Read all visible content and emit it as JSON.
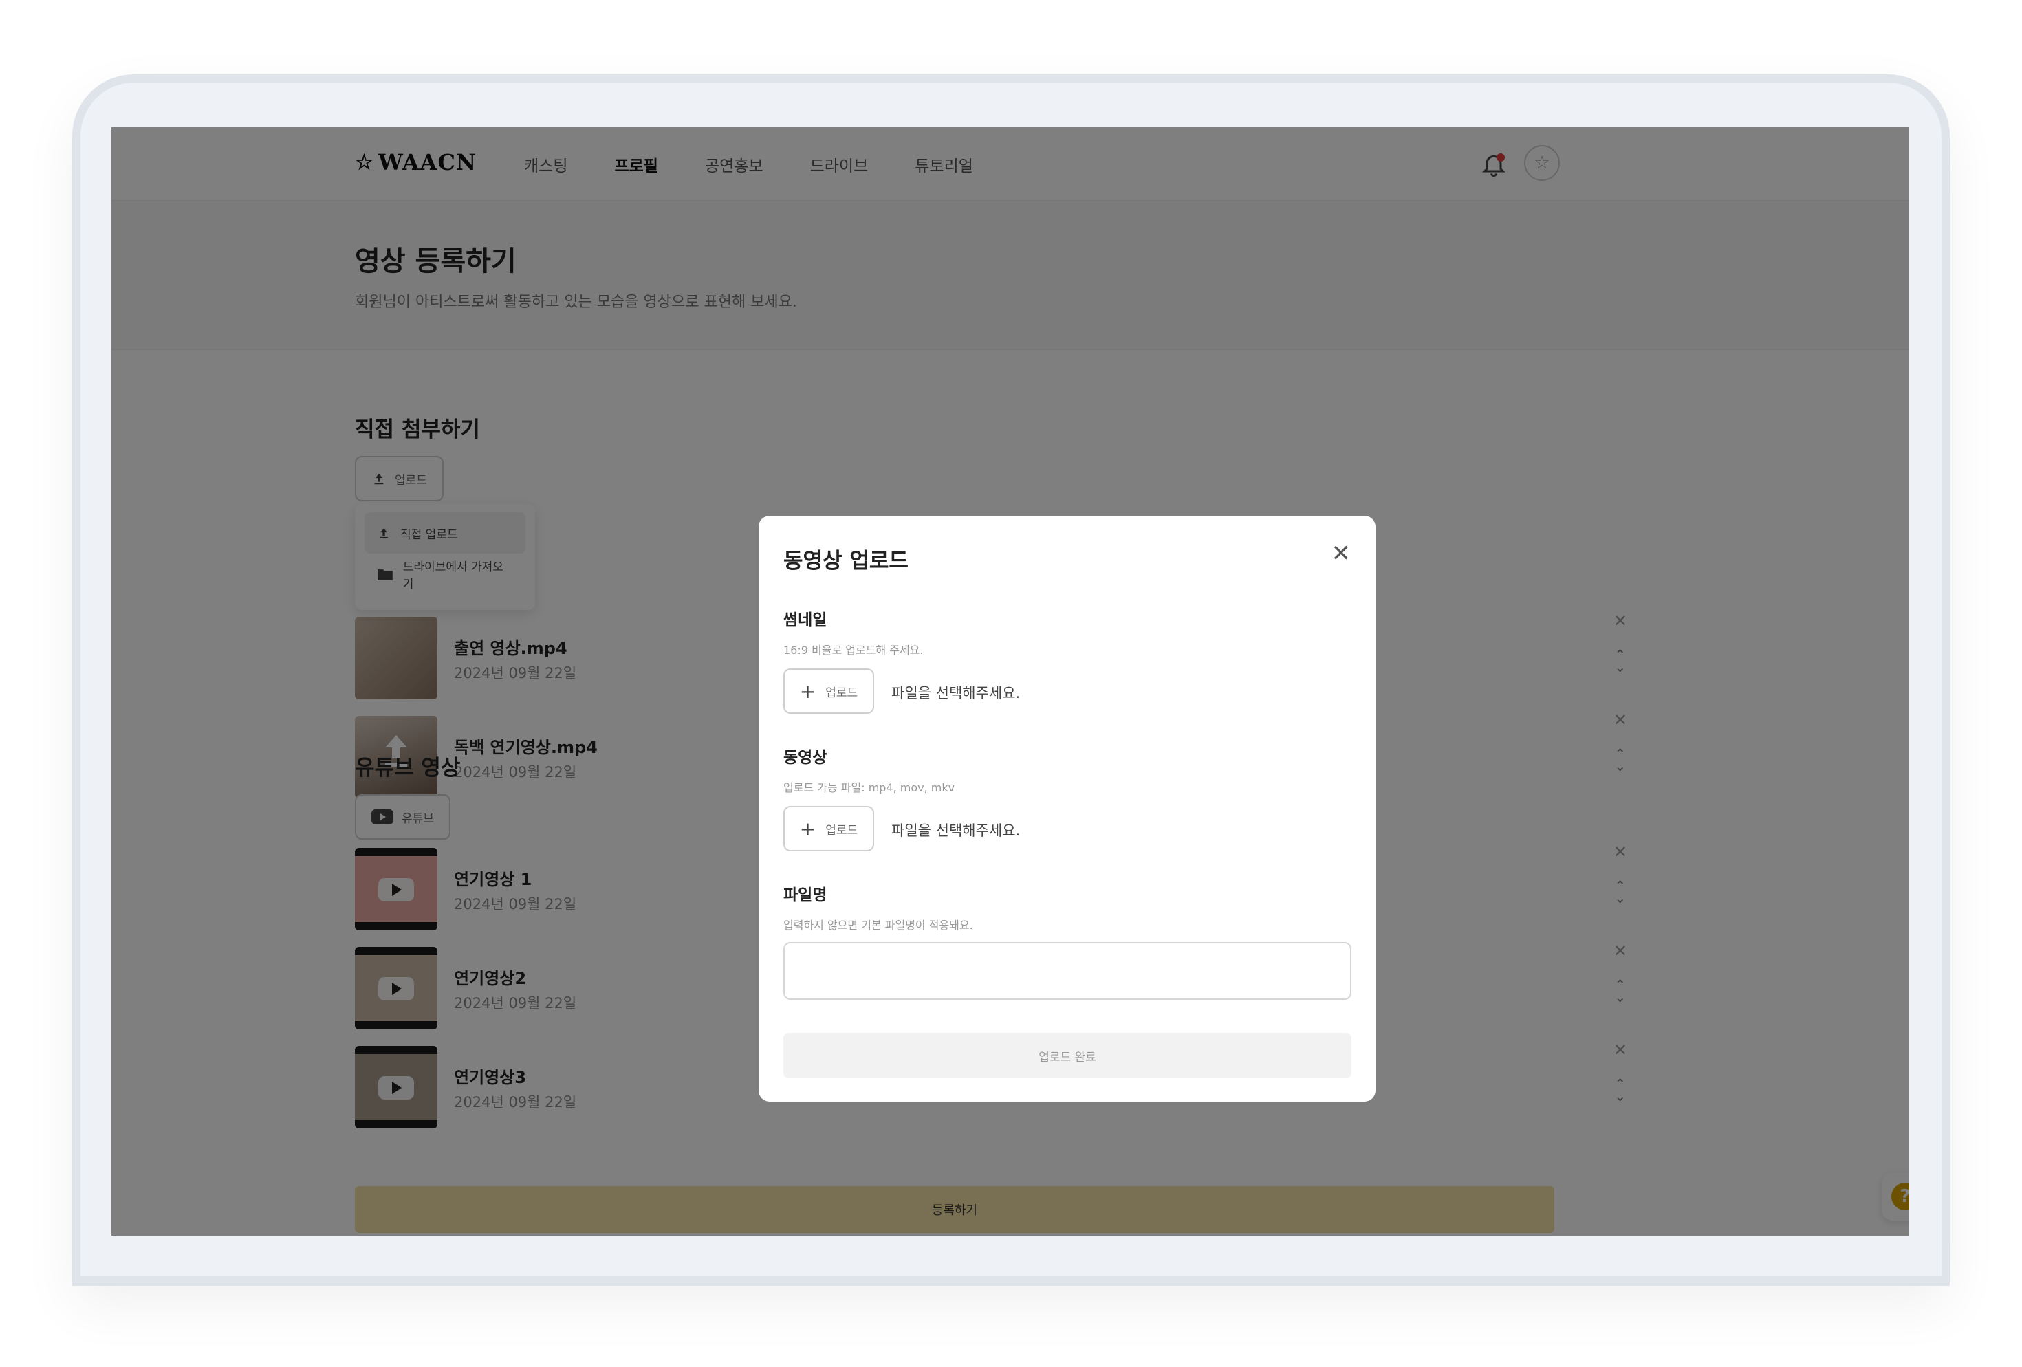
{
  "header": {
    "logo": "WAACN",
    "nav": [
      "캐스팅",
      "프로필",
      "공연홍보",
      "드라이브",
      "튜토리얼"
    ],
    "active_nav": "프로필"
  },
  "hero": {
    "title": "영상 등록하기",
    "description": "회원님이 아티스트로써 활동하고 있는 모습을 영상으로 표현해 보세요."
  },
  "direct": {
    "title": "직접 첨부하기",
    "upload_label": "업로드",
    "dropdown": [
      "직접 업로드",
      "드라이브에서 가져오기"
    ],
    "items": [
      {
        "title": "출연 영상.mp4",
        "date": "2024년 09월 22일"
      },
      {
        "title": "독백 연기영상.mp4",
        "date": "2024년 09월 22일"
      }
    ]
  },
  "youtube": {
    "title": "유튜브 영상",
    "button_label": "유튜브",
    "items": [
      {
        "title": "연기영상 1",
        "date": "2024년 09월 22일"
      },
      {
        "title": "연기영상2",
        "date": "2024년 09월 22일"
      },
      {
        "title": "연기영상3",
        "date": "2024년 09월 22일"
      }
    ]
  },
  "submit_label": "등록하기",
  "help_label": "?",
  "modal": {
    "title": "동영상 업로드",
    "thumbnail": {
      "label": "썸네일",
      "hint": "16:9 비율로 업로드해 주세요.",
      "button": "업로드",
      "status": "파일을 선택해주세요."
    },
    "video": {
      "label": "동영상",
      "hint": "업로드 가능 파일: mp4, mov, mkv",
      "button": "업로드",
      "status": "파일을 선택해주세요."
    },
    "filename": {
      "label": "파일명",
      "hint": "입력하지 않으면 기본 파일명이 적용돼요.",
      "value": ""
    },
    "done_label": "업로드 완료"
  },
  "colors": {
    "accent": "#f3dfa5",
    "notification": "#e23a3a",
    "help": "#d6a300"
  }
}
